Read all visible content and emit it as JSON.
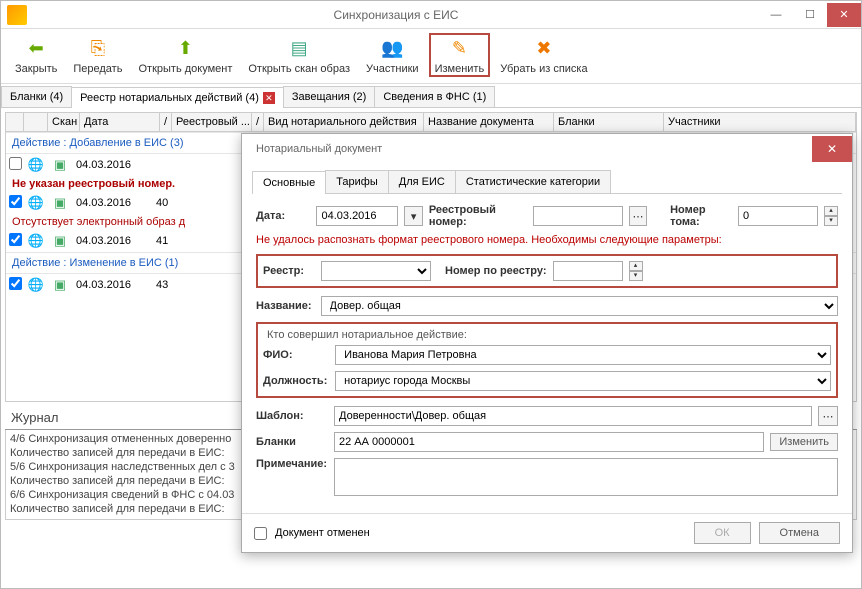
{
  "titlebar": {
    "title": "Синхронизация с ЕИС"
  },
  "toolbar": {
    "close": "Закрыть",
    "send": "Передать",
    "open_doc": "Открыть документ",
    "open_scan": "Открыть скан образ",
    "participants": "Участники",
    "edit": "Изменить",
    "remove": "Убрать из списка"
  },
  "tabs": {
    "blanks": "Бланки (4)",
    "reestr": "Реестр нотариальных действий (4)",
    "wills": "Завещания (2)",
    "fns": "Сведения в ФНС (1)"
  },
  "grid": {
    "cols": {
      "scan": "Скан",
      "date": "Дата",
      "divider": "/",
      "reestr": "Реестровый ...",
      "divider2": "/",
      "action": "Вид нотариального действия",
      "doc": "Название документа",
      "blank": "Бланки",
      "part": "Участники"
    },
    "group_add": "Действие : Добавление в ЕИС (3)",
    "err1": "Не указан реестровый номер.",
    "err2": "Отсутствует электронный образ д",
    "group_mod": "Действие : Изменение в ЕИС (1)",
    "rows": [
      {
        "date": "04.03.2016",
        "num": ""
      },
      {
        "date": "04.03.2016",
        "num": "40"
      },
      {
        "date": "04.03.2016",
        "num": "41"
      },
      {
        "date": "04.03.2016",
        "num": "43"
      }
    ]
  },
  "journal": {
    "title": "Журнал",
    "lines": [
      "4/6 Синхронизация отмененных доверенно",
      "   Количество записей для передачи в ЕИС:",
      "5/6 Синхронизация наследственных дел с 3",
      "   Количество записей для передачи в ЕИС:",
      "6/6 Синхронизация сведений в ФНС с 04.03",
      "   Количество записей для передачи в ЕИС:"
    ]
  },
  "modal": {
    "title": "Нотариальный документ",
    "tabs": {
      "main": "Основные",
      "tariffs": "Тарифы",
      "eis": "Для ЕИС",
      "stat": "Статистические категории"
    },
    "labels": {
      "date": "Дата:",
      "reestr_num": "Реестровый номер:",
      "tom": "Номер тома:",
      "reestr": "Реестр:",
      "by_reestr": "Номер по реестру:",
      "name": "Название:",
      "who_title": "Кто совершил нотариальное действие:",
      "fio": "ФИО:",
      "position": "Должность:",
      "template": "Шаблон:",
      "blanks": "Бланки",
      "note": "Примечание:",
      "cancelled": "Документ отменен",
      "ok": "ОК",
      "cancel": "Отмена",
      "edit_btn": "Изменить"
    },
    "values": {
      "date": "04.03.2016",
      "tom": "0",
      "name": "Довер. общая",
      "fio": "Иванова Мария Петровна",
      "position": "нотариус города Москвы",
      "template": "Доверенности\\Довер. общая",
      "blanks": "22 АА 0000001"
    },
    "error": "Не удалось распознать формат реестрового номера. Необходимы следующие параметры:"
  }
}
